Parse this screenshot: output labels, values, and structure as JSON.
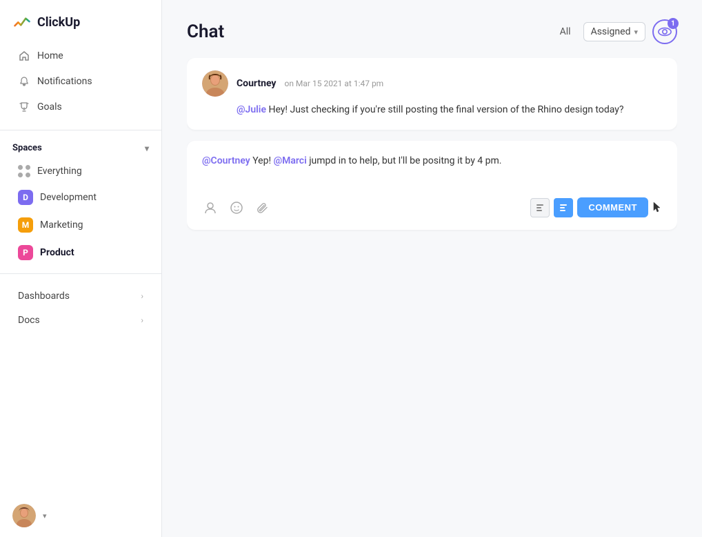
{
  "app": {
    "name": "ClickUp"
  },
  "sidebar": {
    "nav": [
      {
        "id": "home",
        "label": "Home",
        "icon": "home"
      },
      {
        "id": "notifications",
        "label": "Notifications",
        "icon": "bell"
      },
      {
        "id": "goals",
        "label": "Goals",
        "icon": "trophy"
      }
    ],
    "spaces_label": "Spaces",
    "spaces": [
      {
        "id": "everything",
        "label": "Everything",
        "type": "dots"
      },
      {
        "id": "development",
        "label": "Development",
        "badge": "D",
        "color": "#7c6cf0"
      },
      {
        "id": "marketing",
        "label": "Marketing",
        "badge": "M",
        "color": "#f59e0b"
      },
      {
        "id": "product",
        "label": "Product",
        "badge": "P",
        "color": "#ec4899",
        "bold": true
      }
    ],
    "bottom_nav": [
      {
        "id": "dashboards",
        "label": "Dashboards",
        "has_arrow": true
      },
      {
        "id": "docs",
        "label": "Docs",
        "has_arrow": true
      }
    ]
  },
  "chat": {
    "title": "Chat",
    "filter_all": "All",
    "filter_assigned": "Assigned",
    "eye_badge": "1",
    "messages": [
      {
        "id": "msg1",
        "author": "Courtney",
        "time": "on Mar 15 2021 at 1:47 pm",
        "mention": "@Julie",
        "body": " Hey! Just checking if you're still posting the final version of the Rhino design today?"
      }
    ],
    "reply": {
      "mention1": "@Courtney",
      "text1": " Yep! ",
      "mention2": "@Marci",
      "text2": " jumpd in to help, but I'll be positng it by 4 pm."
    },
    "toolbar": {
      "comment_label": "COMMENT"
    }
  }
}
